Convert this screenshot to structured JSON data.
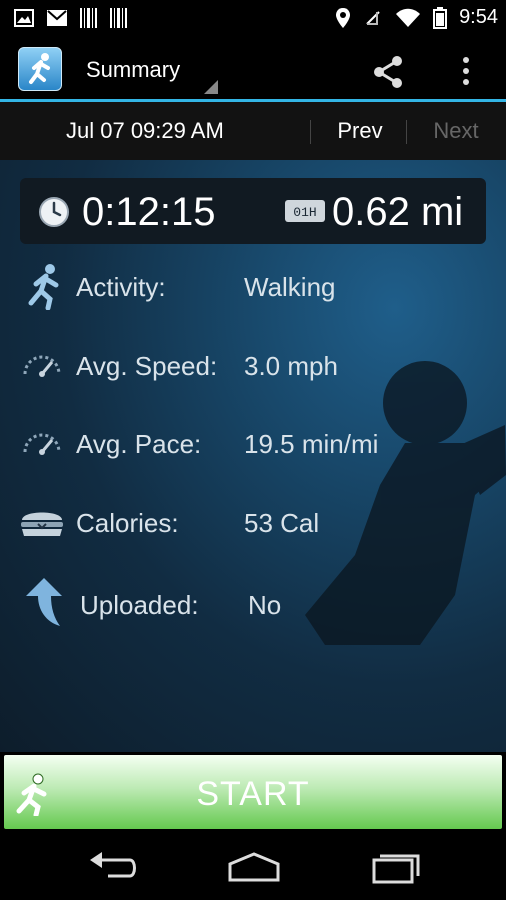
{
  "status_bar": {
    "time": "9:54",
    "icons_left": [
      "picture-icon",
      "gmail-icon",
      "barcode-icon",
      "barcode-icon"
    ],
    "icons_right": [
      "location-icon",
      "signal-off-icon",
      "wifi-icon",
      "battery-icon"
    ]
  },
  "app_bar": {
    "title": "Summary",
    "actions": [
      "share-icon",
      "overflow-menu-icon"
    ]
  },
  "date_bar": {
    "date": "Jul 07 09:29 AM",
    "prev_label": "Prev",
    "next_label": "Next"
  },
  "totals": {
    "duration": "0:12:15",
    "distance": "0.62 mi",
    "odometer_icon_text": "01H"
  },
  "stats": [
    {
      "label": "Activity:",
      "value": "Walking",
      "icon": "runner-icon"
    },
    {
      "label": "Avg. Speed:",
      "value": "3.0 mph",
      "icon": "speedometer-icon"
    },
    {
      "label": "Avg. Pace:",
      "value": "19.5 min/mi",
      "icon": "speedometer-icon"
    },
    {
      "label": "Calories:",
      "value": "53 Cal",
      "icon": "burger-icon"
    },
    {
      "label": "Uploaded:",
      "value": "No",
      "icon": "upload-arrow-icon"
    }
  ],
  "start_button": {
    "label": "START"
  },
  "colors": {
    "accent": "#33b5e5",
    "start_green": "#65c94f",
    "background": "#112c42"
  }
}
